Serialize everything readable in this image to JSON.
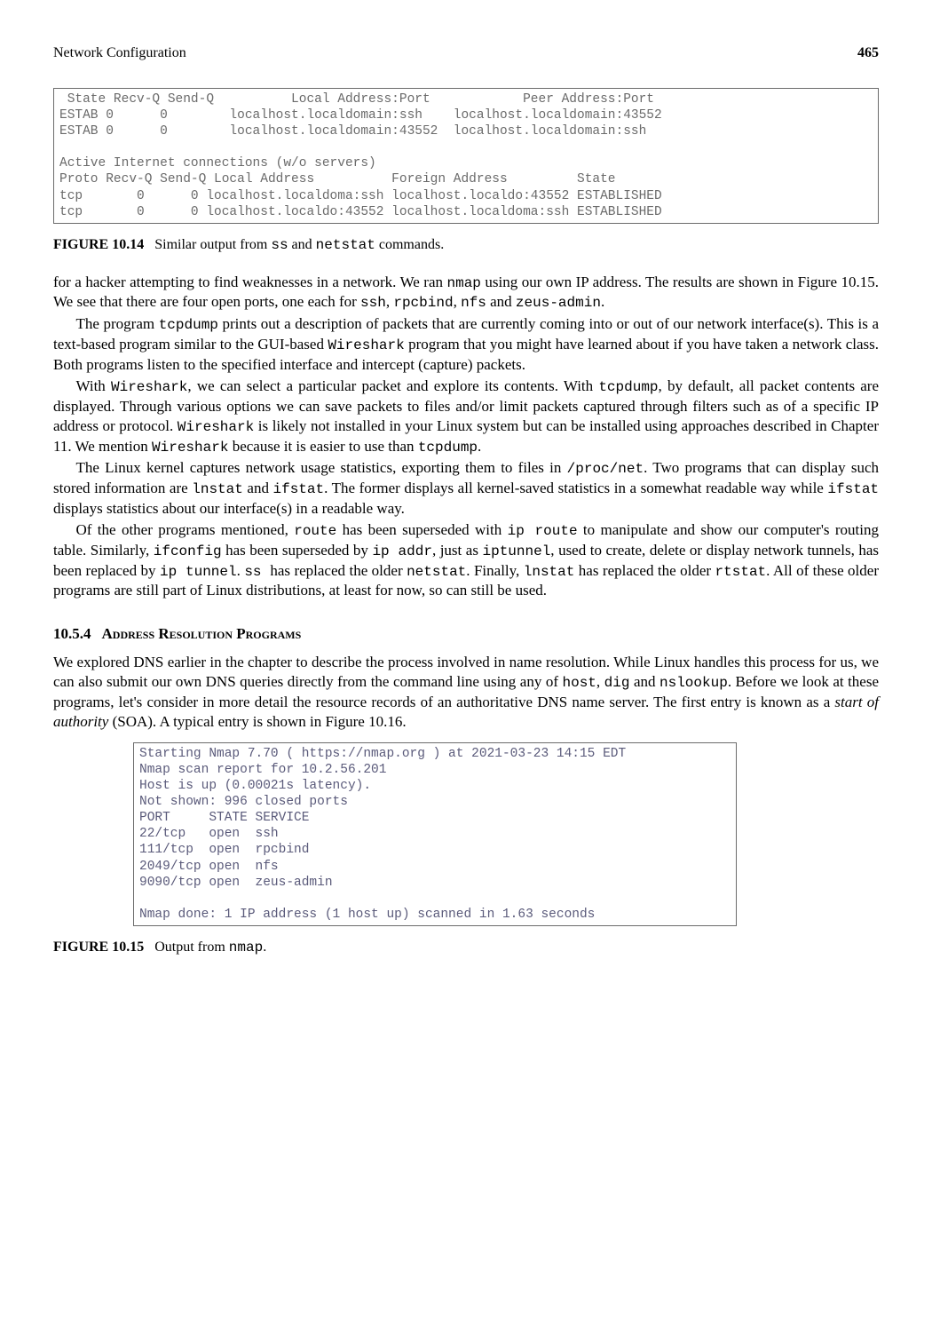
{
  "header": {
    "left": "Network Configuration",
    "right": "465"
  },
  "terminal1": " State Recv-Q Send-Q          Local Address:Port            Peer Address:Port\nESTAB 0      0        localhost.localdomain:ssh    localhost.localdomain:43552\nESTAB 0      0        localhost.localdomain:43552  localhost.localdomain:ssh\n\nActive Internet connections (w/o servers)\nProto Recv-Q Send-Q Local Address          Foreign Address         State\ntcp       0      0 localhost.localdoma:ssh localhost.localdo:43552 ESTABLISHED\ntcp       0      0 localhost.localdo:43552 localhost.localdoma:ssh ESTABLISHED",
  "fig14": {
    "label": "FIGURE 10.14",
    "caption_a": "Similar output from ",
    "cmd1": "ss",
    "mid": " and ",
    "cmd2": "netstat",
    "caption_b": " commands."
  },
  "para1": {
    "a": "for a hacker attempting to find weaknesses in a network. We ran ",
    "nmap": "nmap",
    "b": " using our own IP address. The results are shown in Figure 10.15. We see that there are four open ports, one each for ",
    "ssh": "ssh",
    "c": ", ",
    "rpcbind": "rpcbind",
    "d": ", ",
    "nfs": "nfs",
    "e": " and ",
    "zeus": "zeus-admin",
    "f": "."
  },
  "para2": {
    "a": "The program ",
    "tcpdump": "tcpdump",
    "b": " prints out a description of packets that are currently coming into or out of our network interface(s). This is a text-based program similar to the GUI-based ",
    "wireshark": "Wireshark",
    "c": " program that you might have learned about if you have taken a network class. Both programs listen to the specified interface and intercept (capture) packets."
  },
  "para3": {
    "a": "With ",
    "wireshark": "Wireshark",
    "b": ", we can select a particular packet and explore its contents. With ",
    "tcpdump": "tcpdump",
    "c": ", by default, all packet contents are displayed. Through various options we can save packets to files and/or limit packets captured through filters such as of a specific IP address or protocol. ",
    "wireshark2": "Wireshark",
    "d": " is likely not installed in your Linux system but can be installed using approaches described in Chapter 11. We mention ",
    "wireshark3": "Wireshark",
    "e": " because it is easier to use than ",
    "tcpdump2": "tcpdump",
    "f": "."
  },
  "para4": {
    "a": "The Linux kernel captures network usage statistics, exporting them to files in ",
    "proc": "/proc/net",
    "b": ". Two programs that can display such stored information are ",
    "lnstat": "lnstat",
    "c": " and ",
    "ifstat": "ifstat",
    "d": ". The former displays all kernel-saved statistics in a somewhat readable way while ",
    "ifstat2": "ifstat",
    "e": " displays statistics about our interface(s) in a readable way."
  },
  "para5": {
    "a": "Of the other programs mentioned, ",
    "route": "route",
    "b": " has been superseded with ",
    "iproute": "ip  route",
    "c": " to manipulate and show our computer's routing table. Similarly, ",
    "ifconfig": "ifconfig",
    "d": " has been superseded by ",
    "ipaddr": "ip  addr",
    "e": ", just as ",
    "iptunnel": "iptunnel",
    "f": ", used to create, delete or display network tunnels, has been replaced by ",
    "iptunnel2": "ip tunnel",
    "g": ". ",
    "ss": "ss ",
    "h": " has replaced the older ",
    "netstat": "netstat",
    "i": ". Finally, ",
    "lnstat": "lnstat",
    "j": " has replaced the older ",
    "rtstat": "rtstat",
    "k": ". All of these older programs are still part of Linux distributions, at least for now, so can still be used."
  },
  "section": {
    "num": "10.5.4",
    "title": "Address Resolution Programs"
  },
  "para6": {
    "a": "We explored DNS earlier in the chapter to describe the process involved in name resolution. While Linux handles this process for us, we can also submit our own DNS queries directly from the command line using any of ",
    "host": "host",
    "b": ", ",
    "dig": "dig",
    "c": " and ",
    "nslookup": "nslookup",
    "d": ". Before we look at these programs, let's consider in more detail the resource records of an authoritative DNS name server. The first entry is known as a ",
    "soa": "start of authority",
    "e": " (SOA). A typical entry is shown in Figure 10.16."
  },
  "terminal2": "Starting Nmap 7.70 ( https://nmap.org ) at 2021-03-23 14:15 EDT\nNmap scan report for 10.2.56.201\nHost is up (0.00021s latency).\nNot shown: 996 closed ports\nPORT     STATE SERVICE\n22/tcp   open  ssh\n111/tcp  open  rpcbind\n2049/tcp open  nfs\n9090/tcp open  zeus-admin\n\nNmap done: 1 IP address (1 host up) scanned in 1.63 seconds",
  "fig15": {
    "label": "FIGURE 10.15",
    "caption_a": "Output from ",
    "nmap": "nmap",
    "caption_b": "."
  }
}
